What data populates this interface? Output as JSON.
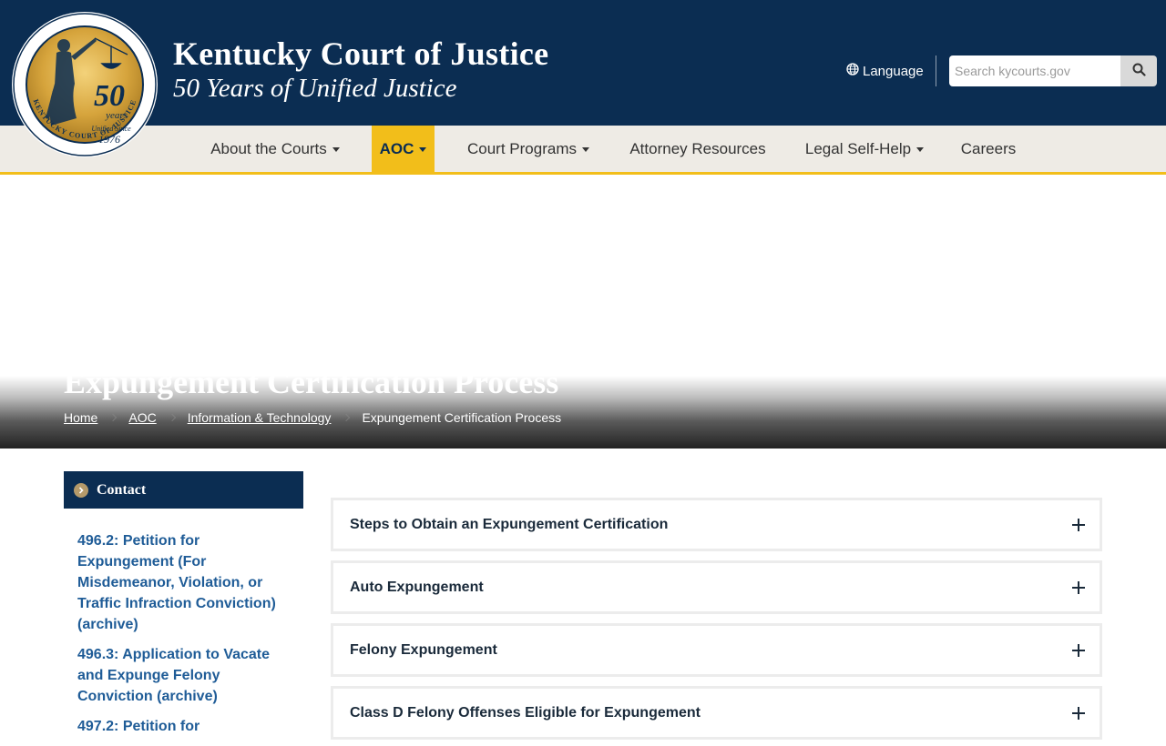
{
  "header": {
    "title": "Kentucky Court of Justice",
    "subtitle": "50 Years of Unified Justice",
    "language_label": "Language",
    "search_placeholder": "Search kycourts.gov"
  },
  "seal": {
    "big_number": "50",
    "years_text": "years",
    "unified_text": "Unified Since",
    "year_text": "1976",
    "ring_text": "KENTUCKY COURT OF JUSTICE"
  },
  "nav": {
    "items": [
      {
        "label": "About the Courts",
        "has_caret": true
      },
      {
        "label": "AOC",
        "has_caret": true,
        "active": true
      },
      {
        "label": "Court Programs",
        "has_caret": true
      },
      {
        "label": "Attorney Resources",
        "has_caret": false
      },
      {
        "label": "Legal Self-Help",
        "has_caret": true
      },
      {
        "label": "Careers",
        "has_caret": false
      }
    ]
  },
  "hero": {
    "title": "Expungement Certification Process",
    "breadcrumb": [
      "Home",
      "AOC",
      "Information & Technology",
      "Expungement Certification Process"
    ]
  },
  "sidebar": {
    "header_label": "Contact",
    "links": [
      "496.2: Petition for Expungement (For Misdemeanor, Violation, or Traffic Infraction Conviction) (archive)",
      "496.3: Application to Vacate and Expunge Felony Conviction (archive)",
      "497.2: Petition for"
    ]
  },
  "accordions": [
    "Steps to Obtain an Expungement Certification",
    "Auto Expungement",
    "Felony Expungement",
    "Class D Felony Offenses Eligible for Expungement"
  ],
  "colors": {
    "navy": "#0b2d52",
    "gold": "#f2be1a",
    "nav_bg": "#eeebe5",
    "link_blue": "#1f5c97"
  }
}
